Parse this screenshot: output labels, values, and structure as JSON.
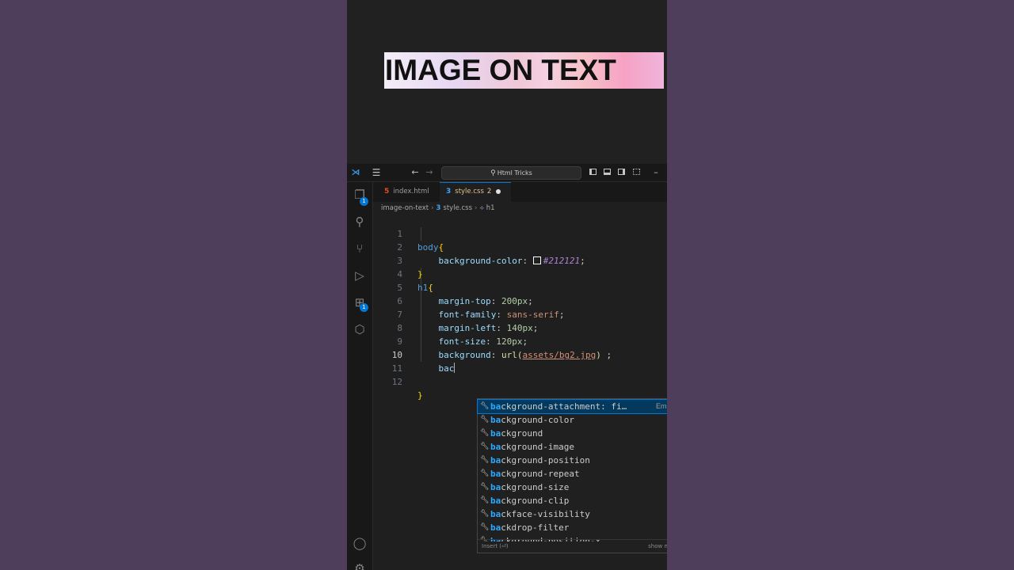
{
  "preview": {
    "heading": "IMAGE ON TEXT"
  },
  "titlebar": {
    "vscode_icon": "vscode-logo-icon",
    "search_text": "Html Tricks"
  },
  "activity": {
    "explorer_badge": "1",
    "extensions_badge": "1"
  },
  "tabs": [
    {
      "label": "index.html",
      "icon": "html-file-icon"
    },
    {
      "label": "style.css",
      "icon": "css-file-icon",
      "problems": "2"
    }
  ],
  "breadcrumb": {
    "folder": "image-on-text",
    "file": "style.css",
    "symbol": "h1"
  },
  "editor": {
    "line_numbers": [
      "1",
      "2",
      "3",
      "4",
      "5",
      "6",
      "7",
      "8",
      "9",
      "10",
      "11",
      "12"
    ],
    "active_line": "10",
    "code": {
      "l1_sel": "body",
      "l1_brace": "{",
      "l2_prop": "background-color",
      "l2_val": "#212121",
      "l3": "}",
      "l4_sel": "h1",
      "l4_brace": "{",
      "l5_prop": "margin-top",
      "l5_num": "200",
      "l5_unit": "px",
      "l6_prop": "font-family",
      "l6_val": "sans-serif",
      "l7_prop": "margin-left",
      "l7_num": "140",
      "l7_unit": "px",
      "l8_prop": "font-size",
      "l8_num": "120",
      "l8_unit": "px",
      "l9_prop": "background",
      "l9_fn": "url(",
      "l9_str": "assets/bg2.jpg",
      "l9_end": ") ;",
      "l10_typed": "bac",
      "l12": "}"
    }
  },
  "suggest": {
    "match_prefix": "ba",
    "items": [
      {
        "match": "ba",
        "rest": "ckground-attachment: fi…",
        "detail": "Emmet Ab"
      },
      {
        "match": "ba",
        "rest": "ckground-color"
      },
      {
        "match": "ba",
        "rest": "ckground"
      },
      {
        "match": "ba",
        "rest": "ckground-image"
      },
      {
        "match": "ba",
        "rest": "ckground-position"
      },
      {
        "match": "ba",
        "rest": "ckground-repeat"
      },
      {
        "match": "ba",
        "rest": "ckground-size"
      },
      {
        "match": "ba",
        "rest": "ckground-clip"
      },
      {
        "match": "ba",
        "rest": "ckface-visibility"
      },
      {
        "match": "ba",
        "rest": "ckdrop-filter"
      },
      {
        "match": "ba",
        "rest": "ckground-position-x"
      }
    ],
    "footer_insert": "Insert (⏎)",
    "footer_more": "show more (Ctrl"
  },
  "colors": {
    "swatch": "#212121",
    "accent": "#0078d4"
  }
}
